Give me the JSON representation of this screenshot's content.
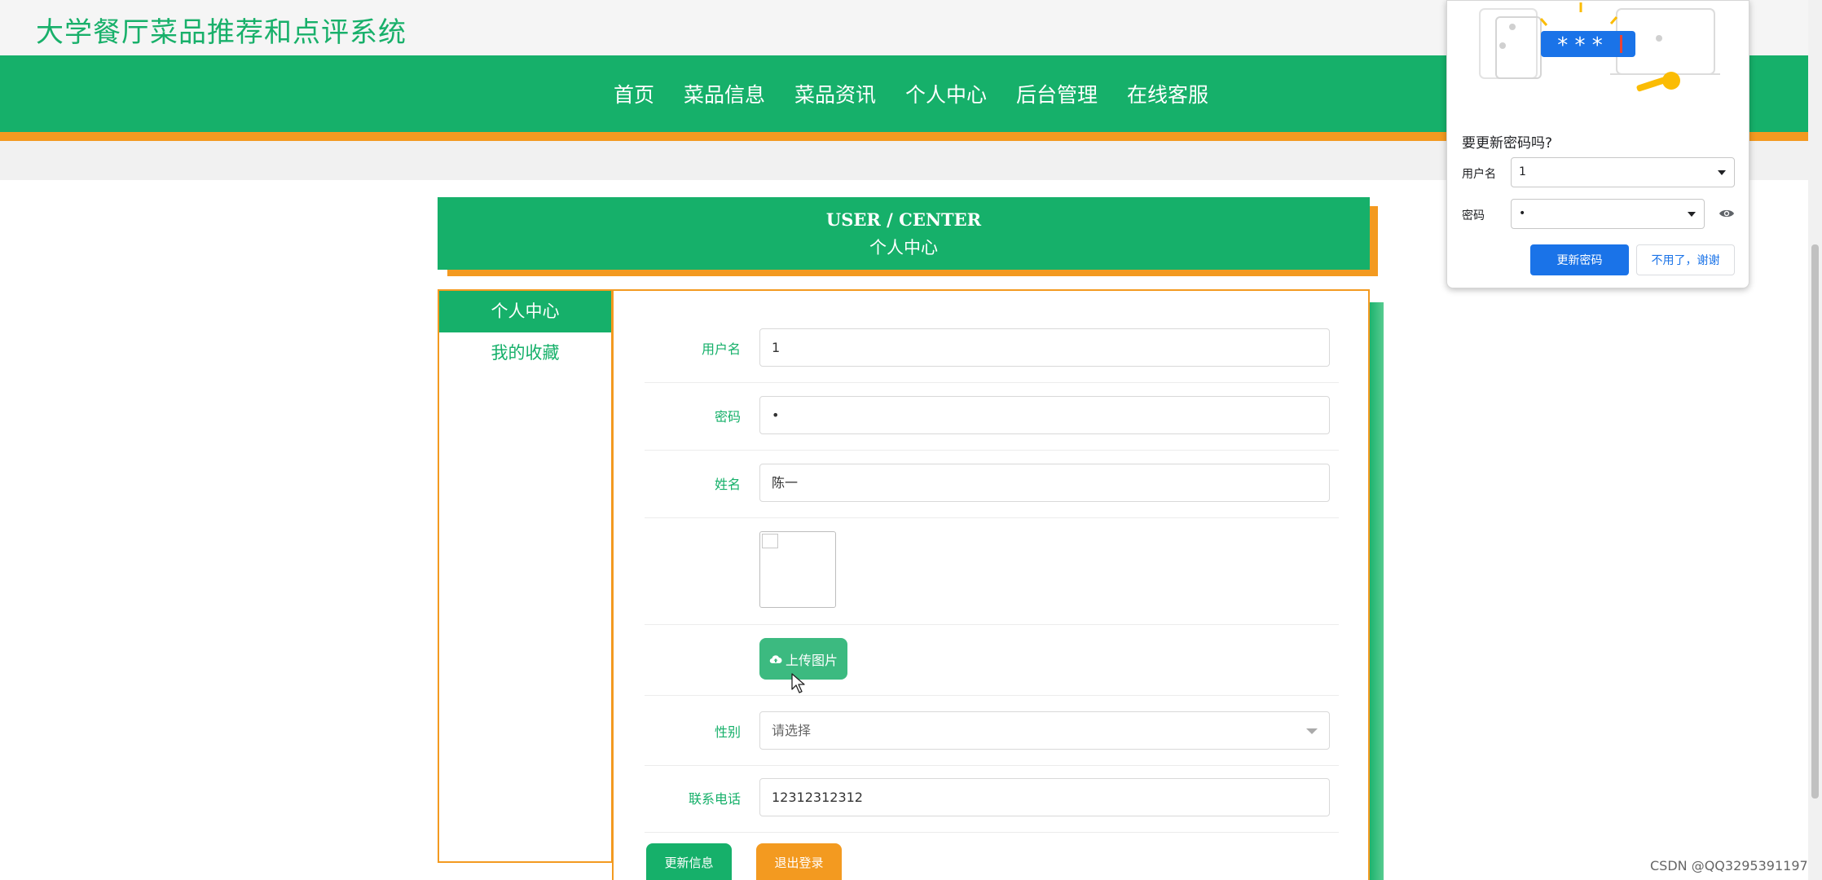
{
  "site": {
    "title": "大学餐厅菜品推荐和点评系统"
  },
  "nav": {
    "items": [
      "首页",
      "菜品信息",
      "菜品资讯",
      "个人中心",
      "后台管理",
      "在线客服"
    ]
  },
  "banner": {
    "en": "USER / CENTER",
    "zh": "个人中心"
  },
  "sidebar": {
    "items": [
      {
        "label": "个人中心",
        "active": true
      },
      {
        "label": "我的收藏",
        "active": false
      }
    ]
  },
  "form": {
    "username_label": "用户名",
    "username_value": "1",
    "password_label": "密码",
    "password_value": "•",
    "name_label": "姓名",
    "name_value": "陈一",
    "upload_label": "上传图片",
    "gender_label": "性别",
    "gender_value": "请选择",
    "phone_label": "联系电话",
    "phone_value": "12312312312",
    "update_button": "更新信息",
    "logout_button": "退出登录"
  },
  "password_popup": {
    "title": "要更新密码吗?",
    "username_label": "用户名",
    "username_value": "1",
    "password_label": "密码",
    "password_value": "•",
    "update_button": "更新密码",
    "dismiss_button": "不用了，谢谢",
    "illustration_text": "* * *"
  },
  "watermark": "CSDN @QQ3295391197",
  "colors": {
    "green": "#16b06a",
    "orange": "#f39a20",
    "blue": "#1a73e8"
  }
}
